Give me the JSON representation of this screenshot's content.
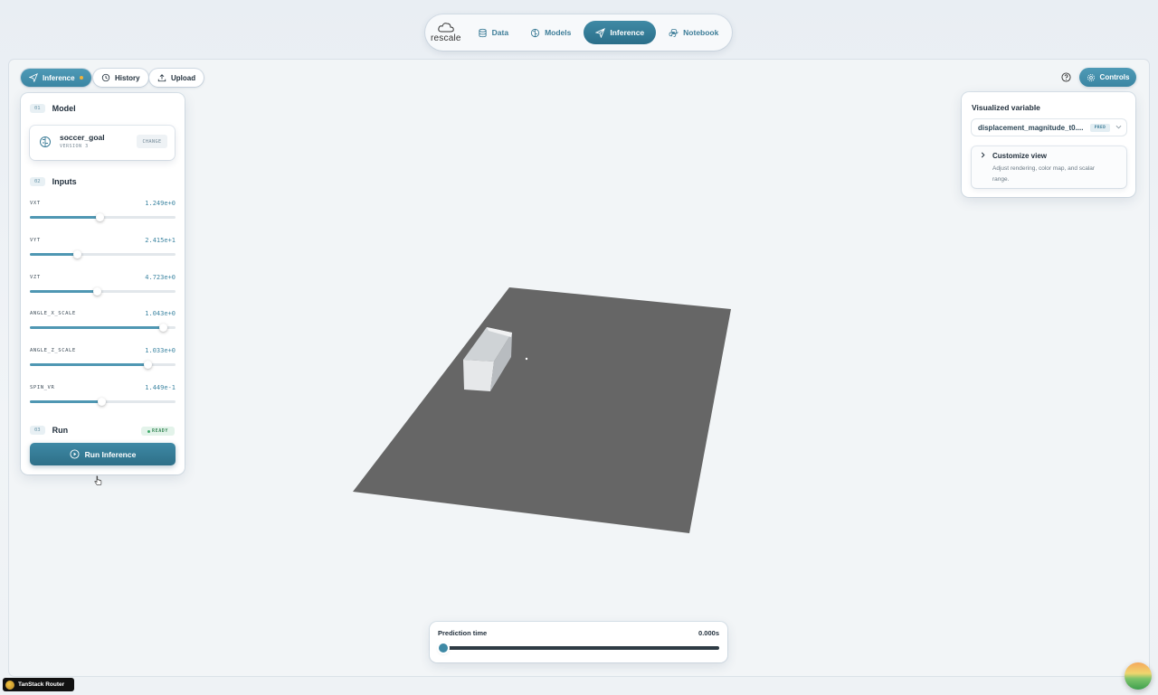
{
  "nav": {
    "logo_text": "rescale",
    "items": [
      {
        "label": "Data",
        "icon": "database-icon"
      },
      {
        "label": "Models",
        "icon": "brain-icon"
      },
      {
        "label": "Inference",
        "icon": "send-icon",
        "active": true
      },
      {
        "label": "Notebook",
        "icon": "python-icon"
      }
    ]
  },
  "toolbar": {
    "inference_label": "Inference",
    "history_label": "History",
    "upload_label": "Upload",
    "controls_label": "Controls"
  },
  "panel": {
    "model_section": {
      "num": "01",
      "title": "Model"
    },
    "model": {
      "name": "soccer_goal",
      "version": "VERSION 3",
      "change_label": "CHANGE"
    },
    "inputs_section": {
      "num": "02",
      "title": "Inputs"
    },
    "inputs": [
      {
        "label": "VXT",
        "value": "1.249e+0",
        "fraction": 0.48
      },
      {
        "label": "VYT",
        "value": "2.415e+1",
        "fraction": 0.32
      },
      {
        "label": "VZT",
        "value": "4.723e+0",
        "fraction": 0.46
      },
      {
        "label": "ANGLE_X_SCALE",
        "value": "1.043e+0",
        "fraction": 0.91
      },
      {
        "label": "ANGLE_Z_SCALE",
        "value": "1.033e+0",
        "fraction": 0.81
      },
      {
        "label": "SPIN_VR",
        "value": "1.449e-1",
        "fraction": 0.49
      }
    ],
    "run_section": {
      "num": "03",
      "title": "Run"
    },
    "status": "READY",
    "run_label": "Run Inference"
  },
  "visualized": {
    "title": "Visualized variable",
    "selected": "displacement_magnitude_t0....",
    "badge": "PRED",
    "customize_title": "Customize view",
    "customize_desc": "Adjust rendering, color map, and scalar range."
  },
  "prediction": {
    "label": "Prediction time",
    "value": "0.000s",
    "fraction": 0
  },
  "devtools": {
    "label": "TanStack Router"
  },
  "colors": {
    "accent": "#3e89a5",
    "plane": "#666666",
    "ready": "#3b8a5a"
  }
}
